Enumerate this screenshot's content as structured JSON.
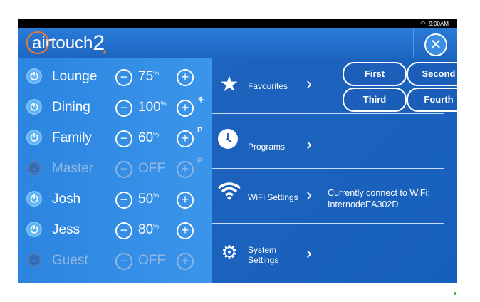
{
  "status_bar": {
    "time": "9:00AM",
    "wifi_icon": "wifi-icon"
  },
  "header": {
    "logo_text": "airtouch",
    "logo_number": "2",
    "logo_plus": "+",
    "close_icon": "close-icon"
  },
  "zones": [
    {
      "name": "Lounge",
      "value": "75",
      "unit": "%",
      "state": "on",
      "flag": ""
    },
    {
      "name": "Dining",
      "value": "100",
      "unit": "%",
      "state": "on",
      "flag": "fan-icon"
    },
    {
      "name": "Family",
      "value": "60",
      "unit": "%",
      "state": "on",
      "flag": "P"
    },
    {
      "name": "Master",
      "value": "OFF",
      "unit": "",
      "state": "off",
      "flag": "P"
    },
    {
      "name": "Josh",
      "value": "50",
      "unit": "%",
      "state": "on",
      "flag": ""
    },
    {
      "name": "Jess",
      "value": "80",
      "unit": "%",
      "state": "on",
      "flag": ""
    },
    {
      "name": "Guest",
      "value": "OFF",
      "unit": "",
      "state": "off",
      "flag": ""
    }
  ],
  "menu": {
    "favourites": {
      "label": "Favourites",
      "icon": "star-icon",
      "buttons": [
        "First",
        "Second",
        "Third",
        "Fourth"
      ]
    },
    "programs": {
      "label": "Programs",
      "icon": "clock-icon"
    },
    "wifi": {
      "label": "WiFi Settings",
      "icon": "wifi-icon",
      "info_line1": "Currently connect to WiFi:",
      "info_line2": "InternodeEA302D"
    },
    "system": {
      "label_line1": "System",
      "label_line2": "Settings",
      "icon": "gears-icon"
    }
  },
  "colors": {
    "accent_orange": "#f07a28",
    "panel_blue": "#1f6ec8",
    "zone_blue": "#2b85e0"
  }
}
